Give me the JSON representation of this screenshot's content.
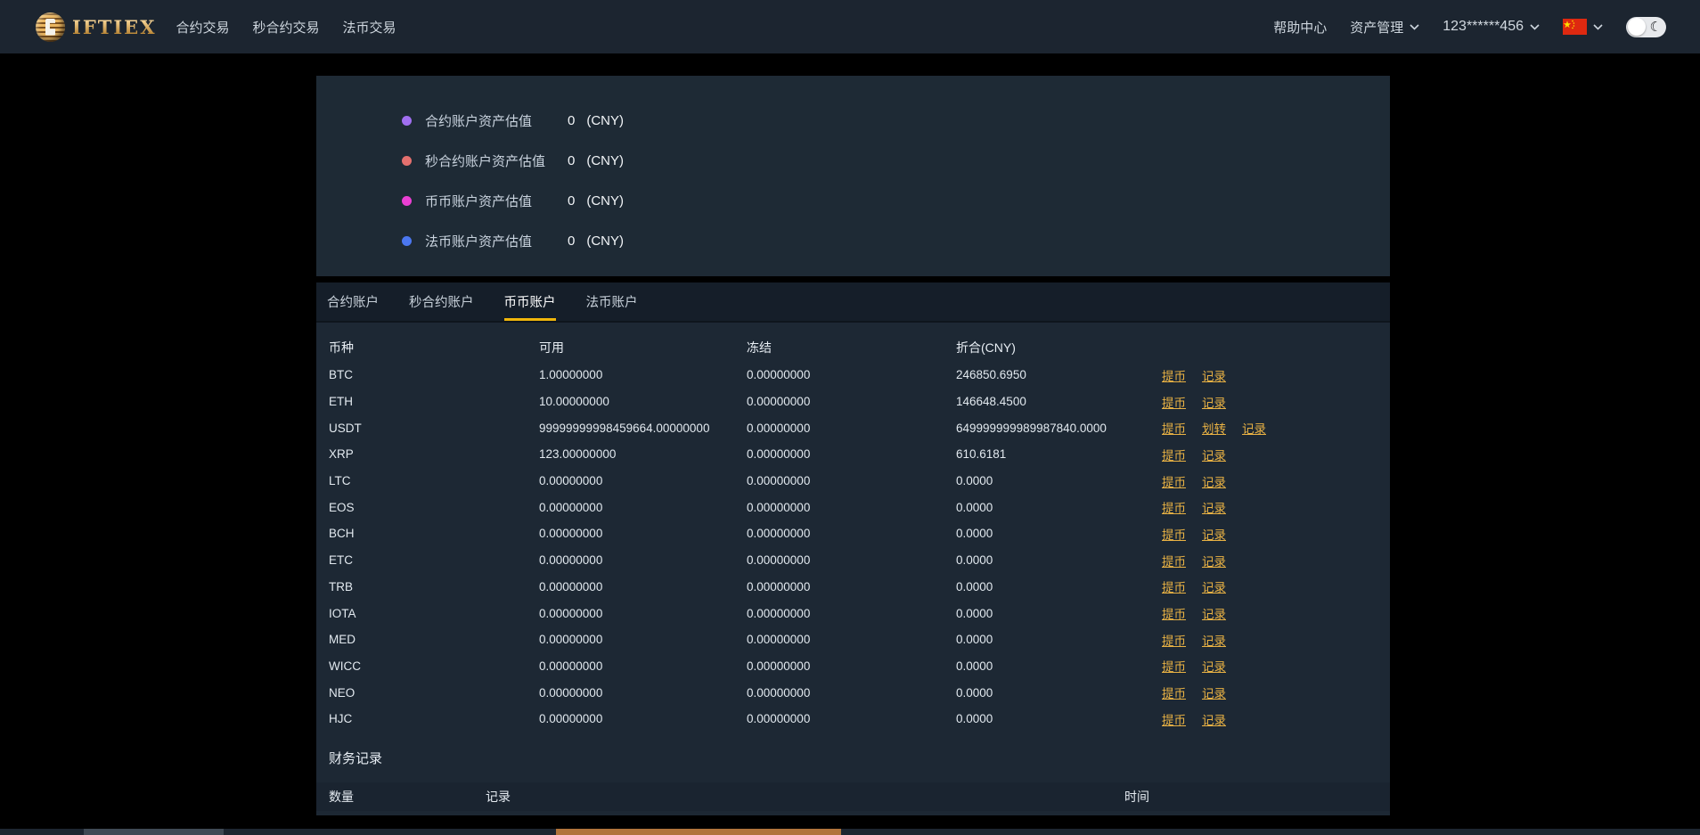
{
  "navbar": {
    "logo_text": "IFTIEX",
    "nav_items": [
      {
        "label": "合约交易"
      },
      {
        "label": "秒合约交易"
      },
      {
        "label": "法币交易"
      }
    ],
    "right": {
      "help_label": "帮助中心",
      "assets_label": "资产管理",
      "account_label": "123******456",
      "language_flag": "china-flag",
      "theme_toggle_state": "light-with-moon"
    }
  },
  "summary": {
    "items": [
      {
        "label": "合约账户资产估值",
        "value": "0",
        "unit": "(CNY)",
        "dot_color": "#a06ff0"
      },
      {
        "label": "秒合约账户资产估值",
        "value": "0",
        "unit": "(CNY)",
        "dot_color": "#e4706e"
      },
      {
        "label": "币币账户资产估值",
        "value": "0",
        "unit": "(CNY)",
        "dot_color": "#ea3fd3"
      },
      {
        "label": "法币账户资产估值",
        "value": "0",
        "unit": "(CNY)",
        "dot_color": "#4b77f0"
      }
    ]
  },
  "tabs": {
    "items": [
      "合约账户",
      "秒合约账户",
      "币币账户",
      "法币账户"
    ],
    "active_index": 2,
    "active_underline_color": "#f0b60b"
  },
  "wallet_table": {
    "headers": [
      "币种",
      "可用",
      "冻结",
      "折合(CNY)"
    ],
    "rows": [
      {
        "symbol": "BTC",
        "available": "1.00000000",
        "frozen": "0.00000000",
        "cny": "246850.6950",
        "actions": [
          "提币",
          "记录"
        ]
      },
      {
        "symbol": "ETH",
        "available": "10.00000000",
        "frozen": "0.00000000",
        "cny": "146648.4500",
        "actions": [
          "提币",
          "记录"
        ]
      },
      {
        "symbol": "USDT",
        "available": "99999999998459664.00000000",
        "frozen": "0.00000000",
        "cny": "649999999989987840.0000",
        "actions": [
          "提币",
          "划转",
          "记录"
        ]
      },
      {
        "symbol": "XRP",
        "available": "123.00000000",
        "frozen": "0.00000000",
        "cny": "610.6181",
        "actions": [
          "提币",
          "记录"
        ]
      },
      {
        "symbol": "LTC",
        "available": "0.00000000",
        "frozen": "0.00000000",
        "cny": "0.0000",
        "actions": [
          "提币",
          "记录"
        ]
      },
      {
        "symbol": "EOS",
        "available": "0.00000000",
        "frozen": "0.00000000",
        "cny": "0.0000",
        "actions": [
          "提币",
          "记录"
        ]
      },
      {
        "symbol": "BCH",
        "available": "0.00000000",
        "frozen": "0.00000000",
        "cny": "0.0000",
        "actions": [
          "提币",
          "记录"
        ]
      },
      {
        "symbol": "ETC",
        "available": "0.00000000",
        "frozen": "0.00000000",
        "cny": "0.0000",
        "actions": [
          "提币",
          "记录"
        ]
      },
      {
        "symbol": "TRB",
        "available": "0.00000000",
        "frozen": "0.00000000",
        "cny": "0.0000",
        "actions": [
          "提币",
          "记录"
        ]
      },
      {
        "symbol": "IOTA",
        "available": "0.00000000",
        "frozen": "0.00000000",
        "cny": "0.0000",
        "actions": [
          "提币",
          "记录"
        ]
      },
      {
        "symbol": "MED",
        "available": "0.00000000",
        "frozen": "0.00000000",
        "cny": "0.0000",
        "actions": [
          "提币",
          "记录"
        ]
      },
      {
        "symbol": "WICC",
        "available": "0.00000000",
        "frozen": "0.00000000",
        "cny": "0.0000",
        "actions": [
          "提币",
          "记录"
        ]
      },
      {
        "symbol": "NEO",
        "available": "0.00000000",
        "frozen": "0.00000000",
        "cny": "0.0000",
        "actions": [
          "提币",
          "记录"
        ]
      },
      {
        "symbol": "HJC",
        "available": "0.00000000",
        "frozen": "0.00000000",
        "cny": "0.0000",
        "actions": [
          "提币",
          "记录"
        ]
      }
    ]
  },
  "records": {
    "title": "财务记录",
    "headers": [
      "数量",
      "记录",
      "时间"
    ]
  },
  "colors": {
    "page_bg": "#000000",
    "navbar_bg": "#1c2530",
    "panel_bg": "#1e2a35",
    "tabbar_bg": "#151e29",
    "accent_orange": "#f0b60b",
    "link_orange": "#e9b244"
  }
}
